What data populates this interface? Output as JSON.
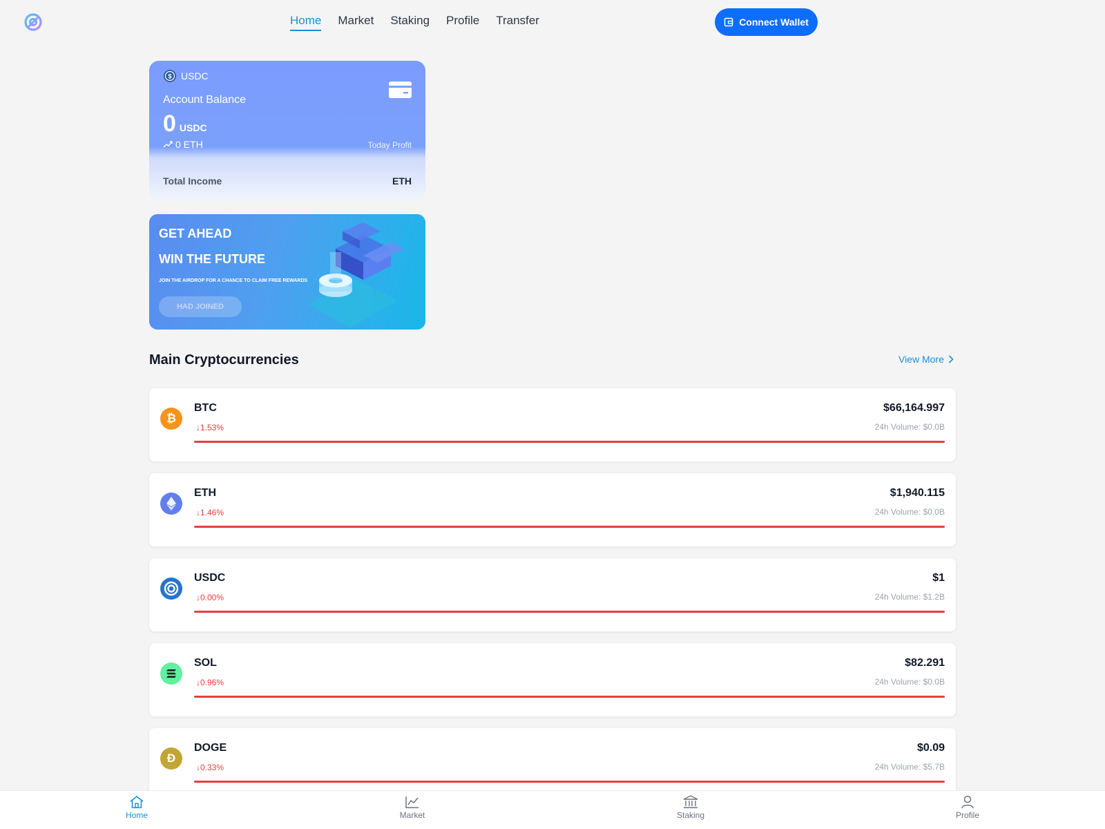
{
  "colors": {
    "accent": "#1a8fd6",
    "primary_button": "#0d6efd",
    "negative": "#e53e3e",
    "background": "#f4f4f5"
  },
  "nav": {
    "logo_icon": "target-logo-icon",
    "links": [
      "Home",
      "Market",
      "Staking",
      "Profile",
      "Transfer"
    ],
    "active": "Home",
    "connect_label": "Connect Wallet",
    "connect_icon": "wallet-icon"
  },
  "balance": {
    "coin": "USDC",
    "label": "Account Balance",
    "amount": "0",
    "amount_unit": "USDC",
    "eth": "0 ETH",
    "today_profit_label": "Today Profit",
    "total_income_label": "Total Income",
    "total_income_unit": "ETH"
  },
  "promo": {
    "line1": "GET AHEAD",
    "line2": "WIN THE FUTURE",
    "subtitle": "JOIN THE AIRDROP FOR A CHANCE TO CLAIM FREE REWARDS",
    "button": "HAD JOINED"
  },
  "section": {
    "title": "Main Cryptocurrencies",
    "view_more": "View More"
  },
  "coins": [
    {
      "symbol": "BTC",
      "change": "↓1.53%",
      "price": "$66,164.997",
      "volume": "24h Volume: $0.0B",
      "icon": "bitcoin-icon",
      "color": "#f7931a"
    },
    {
      "symbol": "ETH",
      "change": "↓1.46%",
      "price": "$1,940.115",
      "volume": "24h Volume: $0.0B",
      "icon": "ethereum-icon",
      "color": "#627eea"
    },
    {
      "symbol": "USDC",
      "change": "↓0.00%",
      "price": "$1",
      "volume": "24h Volume: $1.2B",
      "icon": "usdc-icon",
      "color": "#2775ca"
    },
    {
      "symbol": "SOL",
      "change": "↓0.96%",
      "price": "$82.291",
      "volume": "24h Volume: $0.0B",
      "icon": "solana-icon",
      "color": "#5ff0a0"
    },
    {
      "symbol": "DOGE",
      "change": "↓0.33%",
      "price": "$0.09",
      "volume": "24h Volume: $5.7B",
      "icon": "dogecoin-icon",
      "color": "#c2a633"
    }
  ],
  "tabs": [
    {
      "label": "Home",
      "icon": "home-icon",
      "active": true
    },
    {
      "label": "Market",
      "icon": "chart-line-icon",
      "active": false
    },
    {
      "label": "Staking",
      "icon": "bank-icon",
      "active": false
    },
    {
      "label": "Profile",
      "icon": "user-icon",
      "active": false
    }
  ]
}
